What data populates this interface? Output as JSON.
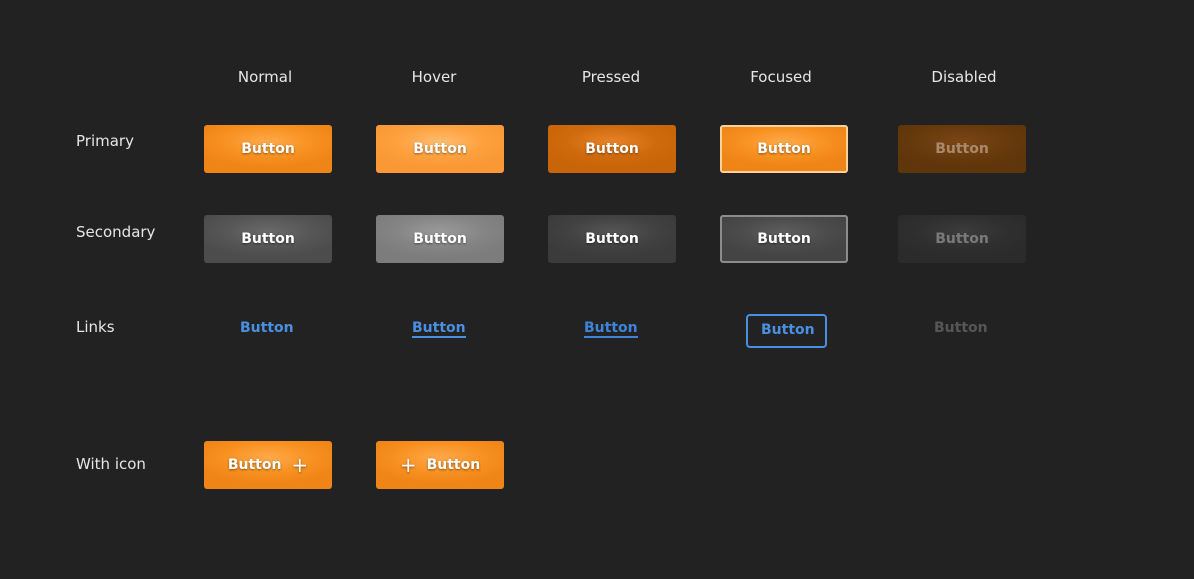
{
  "columns": {
    "normal": "Normal",
    "hover": "Hover",
    "pressed": "Pressed",
    "focused": "Focused",
    "disabled": "Disabled"
  },
  "rows": {
    "primary": "Primary",
    "secondary": "Secondary",
    "links": "Links",
    "with_icon": "With icon"
  },
  "button_label": "Button",
  "icons": {
    "plus": "+"
  },
  "colors": {
    "background": "#222222",
    "primary_orange": "#f7901f",
    "secondary_gray": "#555555",
    "link_blue": "#4a90e2",
    "disabled_text": "#565656"
  }
}
